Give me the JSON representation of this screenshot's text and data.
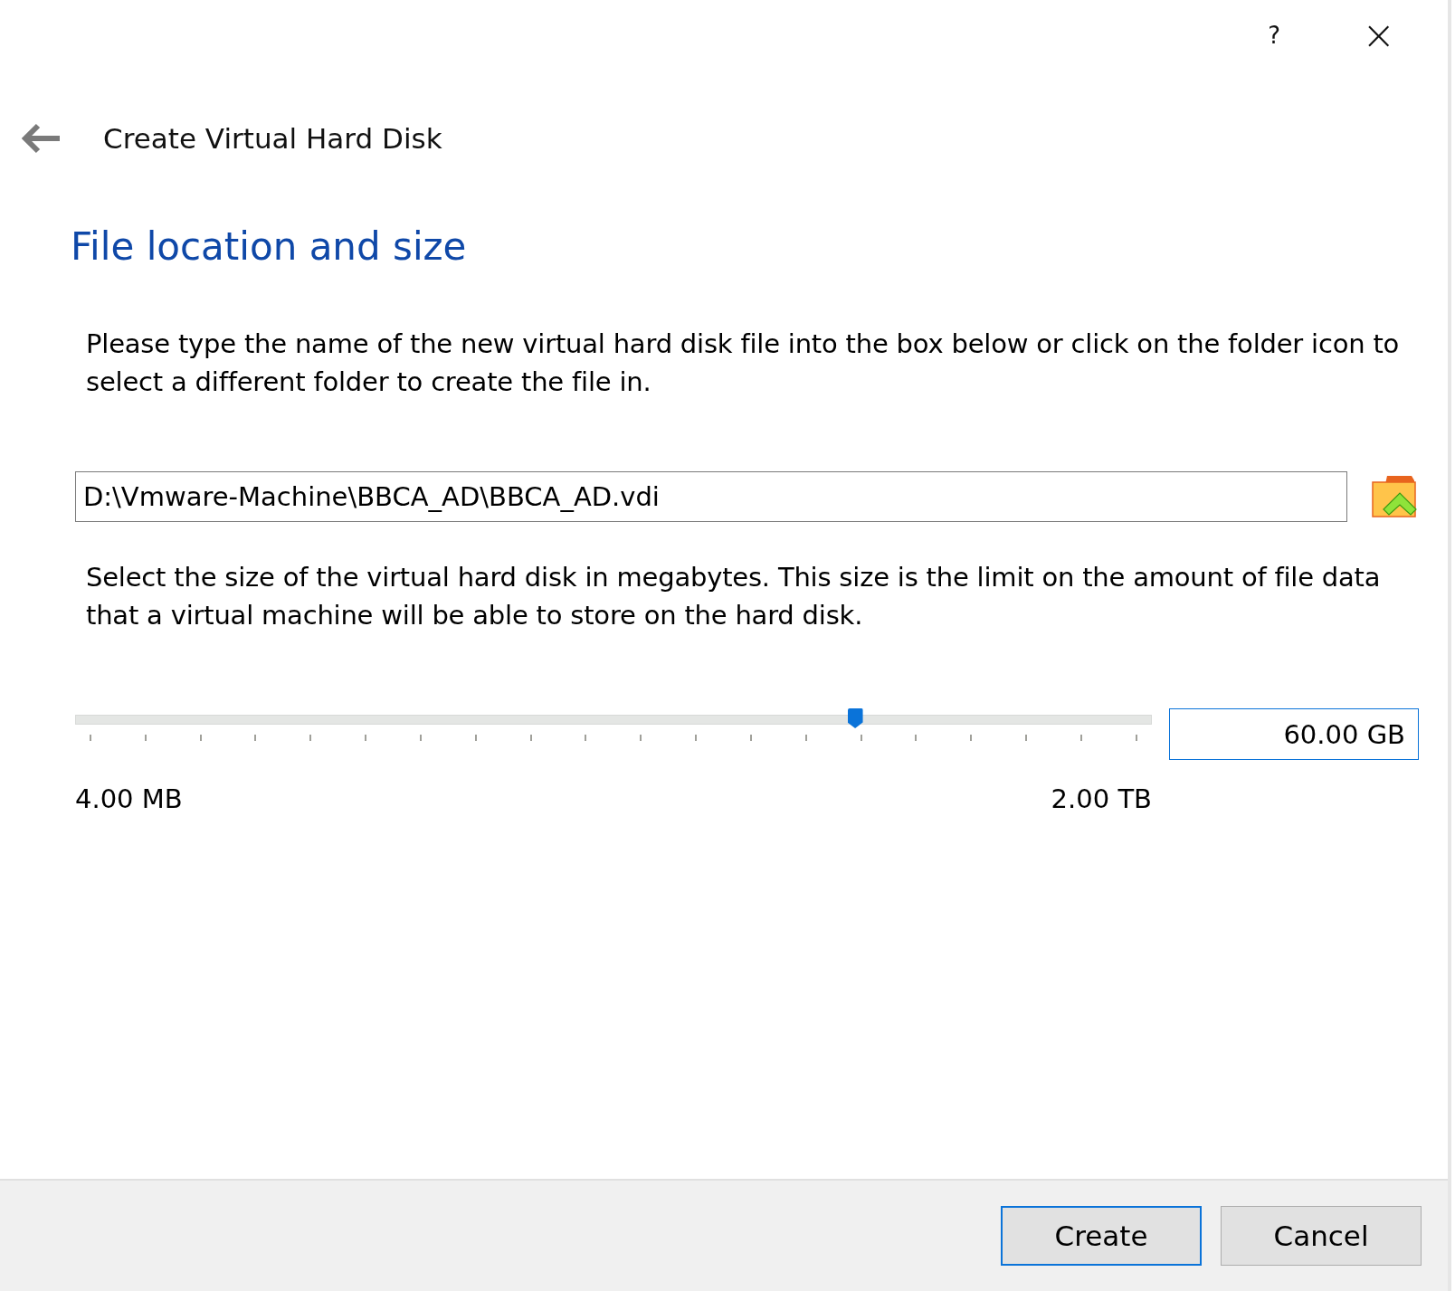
{
  "title_bar": {
    "help": "?",
    "close": "×"
  },
  "wizard": {
    "title": "Create Virtual Hard Disk"
  },
  "page": {
    "heading": "File location and size",
    "location_text": "Please type the name of the new virtual hard disk file into the box below or click on the folder icon to select a different folder to create the file in.",
    "location_value": "D:\\Vmware-Machine\\BBCA_AD\\BBCA_AD.vdi",
    "size_text": "Select the size of the virtual hard disk in megabytes. This size is the limit on the amount of file data that a virtual machine will be able to store on the hard disk.",
    "size_slider": {
      "level": 0.724,
      "min_label": "4.00 MB",
      "max_label": "2.00 TB"
    },
    "size_value": "60.00 GB",
    "size_focused": true
  },
  "buttons": [
    {
      "label": "Create",
      "default": true
    },
    {
      "label": "Cancel",
      "default": false
    }
  ]
}
